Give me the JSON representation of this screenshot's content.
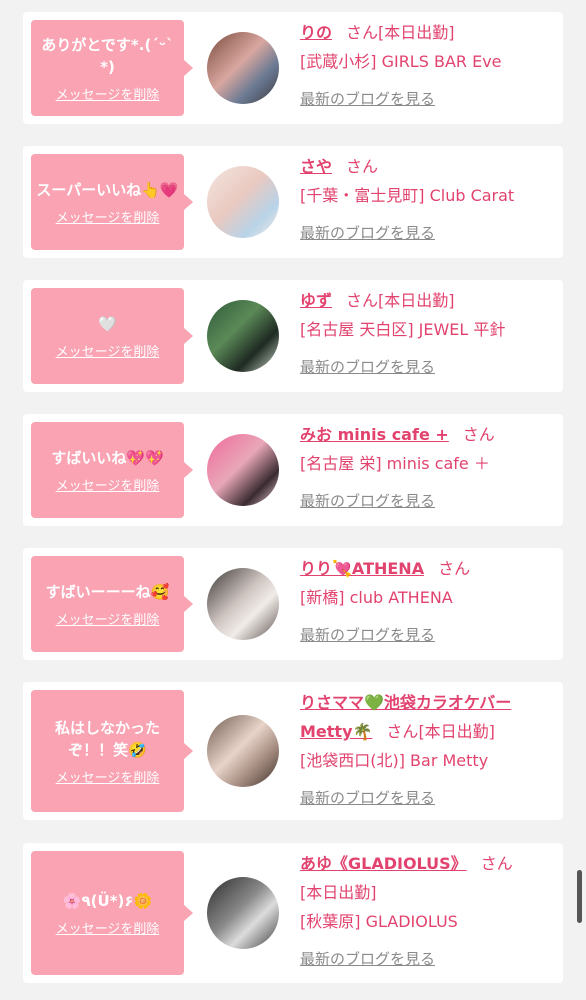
{
  "delete_label": "メッセージを削除",
  "blog_label": "最新のブログを見る",
  "san_label": "さん",
  "cards": [
    {
      "message": "ありがとです*.(ˊᵕˋ*)",
      "name": "りの",
      "status": "[本日出勤]",
      "shop": "[武蔵小杉] GIRLS BAR Eve"
    },
    {
      "message": "スーパーいいね👆💗",
      "name": "さや",
      "status": "",
      "shop": "[千葉・富士見町] Club Carat"
    },
    {
      "message": "🤍",
      "name": "ゆず",
      "status": "[本日出勤]",
      "shop": "[名古屋 天白区] JEWEL 平針"
    },
    {
      "message": "すばいいね💖💖",
      "name": "みお minis cafe +",
      "status": "",
      "shop": "[名古屋 栄] minis cafe ＋"
    },
    {
      "message": "すばいーーーね🥰",
      "name": "りり💘ATHENA",
      "status": "",
      "shop": "[新橋] club ATHENA"
    },
    {
      "message": "私はしなかったぞ！！笑🤣",
      "name_line1": "りさママ💚池袋カラオケバー",
      "name_line2": "Metty🌴",
      "status": "[本日出勤]",
      "shop": "[池袋西口(北)] Bar Metty"
    },
    {
      "message": "🌸٩(Ü*)۶🌼",
      "name": "あゆ《GLADIOLUS》",
      "status": "[本日出勤]",
      "shop": "[秋葉原] GLADIOLUS"
    }
  ]
}
